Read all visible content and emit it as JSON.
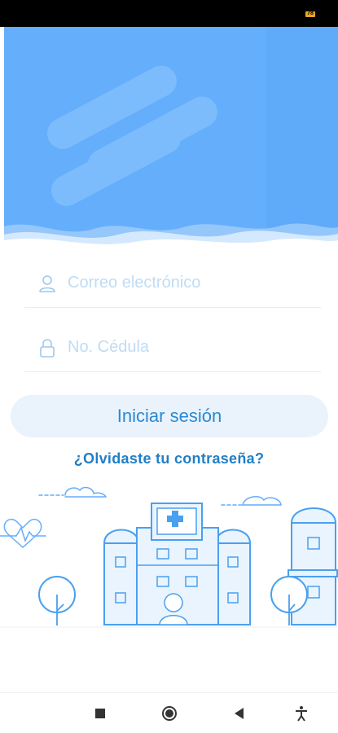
{
  "status_bar": {
    "battery_label": "78"
  },
  "login": {
    "email_placeholder": "Correo electrónico",
    "cedula_placeholder": "No. Cédula",
    "submit_label": "Iniciar sesión",
    "forgot_password": "¿Olvidaste tu contraseña?"
  },
  "colors": {
    "hero_blue": "#64aefc",
    "accent": "#2a89d4",
    "button_bg": "#eaf3fc"
  },
  "icons": {
    "email": "user-icon",
    "cedula": "lock-icon",
    "nav": [
      "recents-square-icon",
      "home-circle-icon",
      "back-triangle-icon",
      "accessibility-icon"
    ]
  }
}
